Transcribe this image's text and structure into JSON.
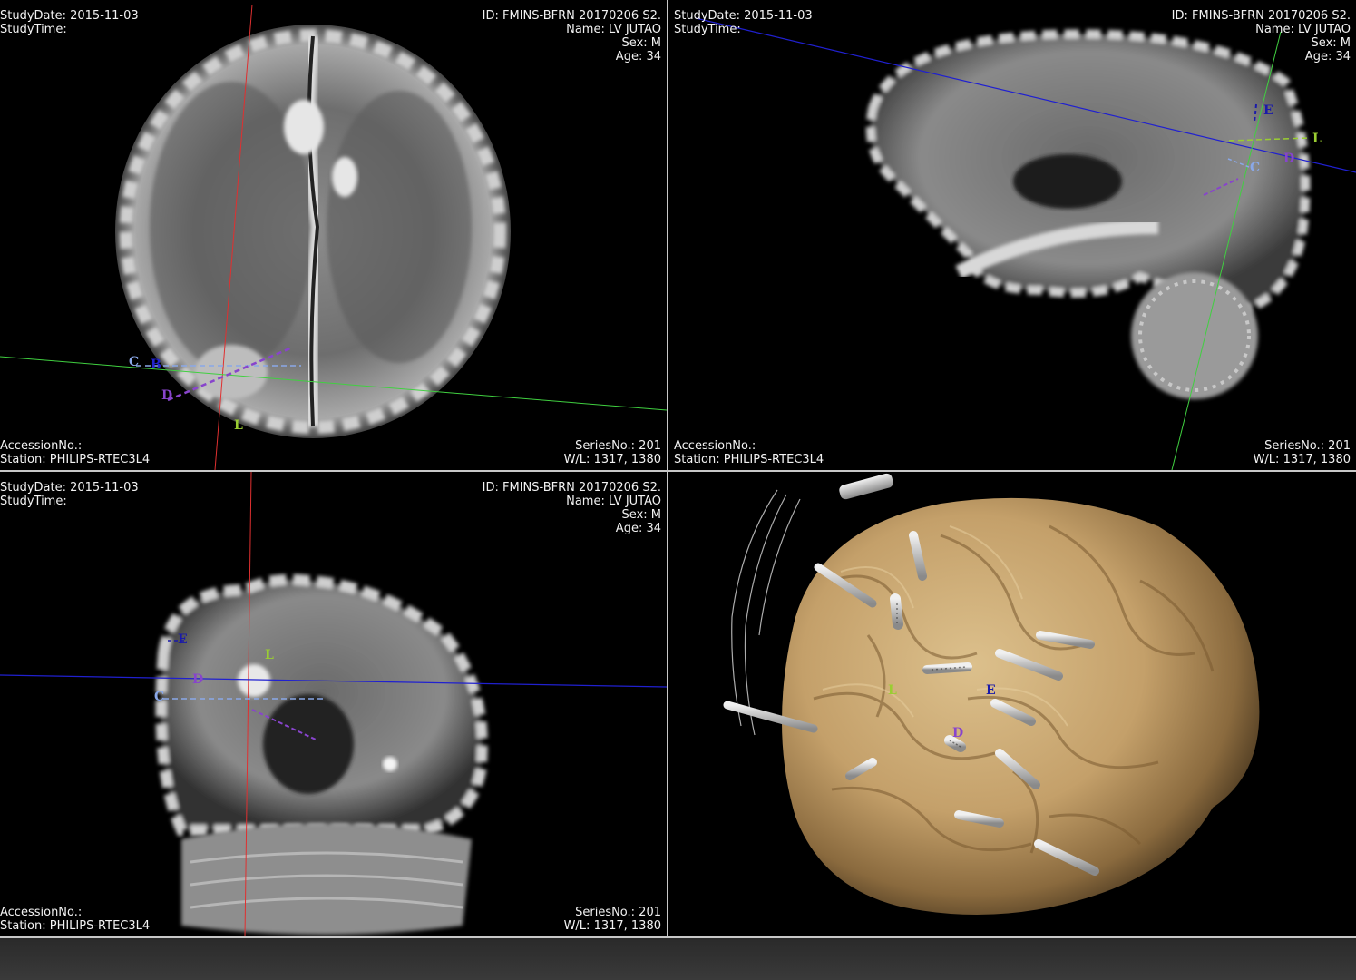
{
  "viewports": [
    {
      "id": "axial",
      "study_date": "StudyDate: 2015-11-03",
      "study_time": "StudyTime:",
      "patient_id": "ID: FMINS-BFRN  20170206 S2.",
      "patient_name": "Name: LV JUTAO",
      "sex": "Sex: M",
      "age": "Age: 34",
      "accession": "AccessionNo.:",
      "station": "Station: PHILIPS-RTEC3L4",
      "series": "SeriesNo.: 201",
      "window_level": "W/L: 1317, 1380"
    },
    {
      "id": "sagittal",
      "study_date": "StudyDate: 2015-11-03",
      "study_time": "StudyTime:",
      "patient_id": "ID: FMINS-BFRN  20170206 S2.",
      "patient_name": "Name: LV JUTAO",
      "sex": "Sex: M",
      "age": "Age: 34",
      "accession": "AccessionNo.:",
      "station": "Station: PHILIPS-RTEC3L4",
      "series": "SeriesNo.: 201",
      "window_level": "W/L: 1317, 1380"
    },
    {
      "id": "coronal",
      "study_date": "StudyDate: 2015-11-03",
      "study_time": "StudyTime:",
      "patient_id": "ID: FMINS-BFRN  20170206 S2.",
      "patient_name": "Name: LV JUTAO",
      "sex": "Sex: M",
      "age": "Age: 34",
      "accession": "AccessionNo.:",
      "station": "Station: PHILIPS-RTEC3L4",
      "series": "SeriesNo.: 201",
      "window_level": "W/L: 1317, 1380"
    }
  ],
  "electrode_labels": {
    "C": "C",
    "B": "B",
    "D": "D",
    "E": "E",
    "L": "L"
  },
  "colors": {
    "crosshair_red": "#e03030",
    "crosshair_green": "#40d040",
    "crosshair_blue": "#2020d0",
    "electrode_C": "#8aa8e8",
    "electrode_B": "#2222cc",
    "electrode_D": "#8844cc",
    "electrode_E": "#1a1aaa",
    "electrode_L": "#9acd32",
    "brain_surface": "#c4a06a",
    "divider": "#c8c8c8"
  }
}
